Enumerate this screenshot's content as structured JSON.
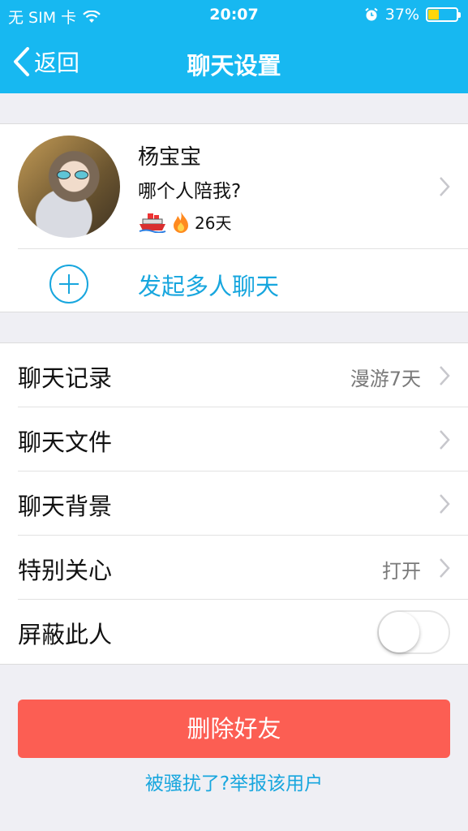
{
  "status_bar": {
    "carrier": "无 SIM 卡",
    "time": "20:07",
    "battery_percent": "37%",
    "battery_level": 0.37,
    "battery_color": "#ffd60a"
  },
  "nav": {
    "back_label": "返回",
    "title": "聊天设置"
  },
  "profile": {
    "name": "杨宝宝",
    "signature": "哪个人陪我?",
    "streak_days": "26天",
    "badge_icons": [
      "ship-icon",
      "flame-icon"
    ]
  },
  "group_chat_label": "发起多人聊天",
  "settings": [
    {
      "label": "聊天记录",
      "value": "漫游7天"
    },
    {
      "label": "聊天文件",
      "value": ""
    },
    {
      "label": "聊天背景",
      "value": ""
    },
    {
      "label": "特别关心",
      "value": "打开"
    },
    {
      "label": "屏蔽此人",
      "toggle": false
    }
  ],
  "delete_button": "删除好友",
  "report_link": "被骚扰了?举报该用户",
  "colors": {
    "header": "#17b8f1",
    "accent": "#17a6de",
    "danger": "#fc5e53",
    "background": "#efeff4"
  }
}
